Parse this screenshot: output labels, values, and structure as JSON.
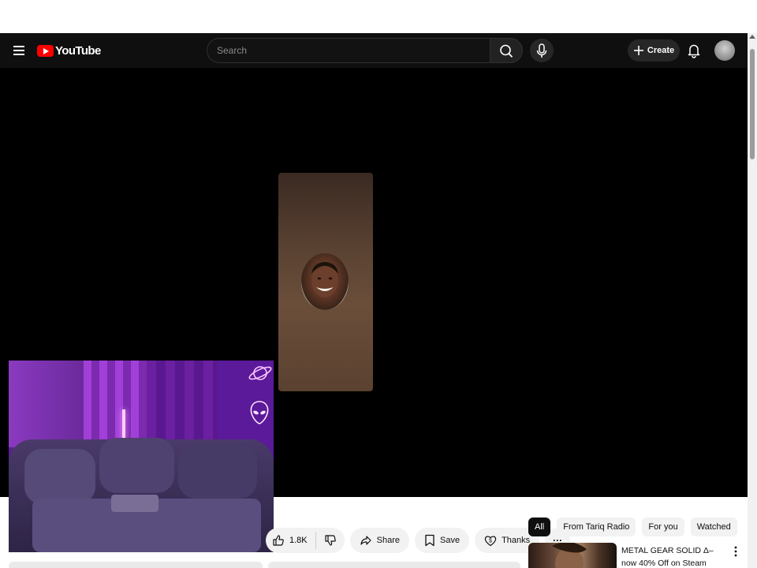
{
  "header": {
    "logo_text": "YouTube",
    "search_placeholder": "Search",
    "create_label": "Create"
  },
  "actions": {
    "like_count": "1.8K",
    "share_label": "Share",
    "save_label": "Save",
    "thanks_label": "Thanks",
    "more_label": "···"
  },
  "chips": [
    {
      "label": "All",
      "active": true
    },
    {
      "label": "From Tariq Radio",
      "active": false
    },
    {
      "label": "For you",
      "active": false
    },
    {
      "label": "Watched",
      "active": false
    }
  ],
  "recommended": [
    {
      "title": "METAL GEAR SOLID Δ– now 40% Off on Steam"
    }
  ],
  "colors": {
    "header_bg": "#0f0f0f",
    "brand_red": "#ff0000",
    "player_bg": "#000000",
    "chip_active": "#0f0f0f"
  },
  "icons": [
    "menu-icon",
    "youtube-logo-icon",
    "search-icon",
    "mic-icon",
    "plus-icon",
    "bell-icon",
    "like-icon",
    "dislike-icon",
    "share-icon",
    "save-icon",
    "thanks-icon",
    "more-vert-icon"
  ]
}
